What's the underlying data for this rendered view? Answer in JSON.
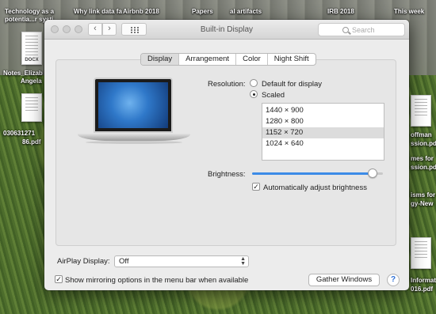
{
  "desktop": {
    "top_labels": [
      "Technology as a",
      "Why link data fa",
      "Airbnb 2018",
      "Papers",
      "al artifacts",
      "IRB 2018",
      "This week"
    ],
    "left_items": [
      {
        "line1": "potentia...r systi",
        "line2": ""
      },
      {
        "line1": "Notes_Elizab",
        "line2": "Angela"
      },
      {
        "line1": "030631271",
        "line2": "86.pdf"
      }
    ],
    "right_items": [
      "offman",
      "ssion.pdf",
      "mes for",
      "ssion.pdf",
      "isms for",
      "gy-New",
      "Informat",
      "016.pdf"
    ],
    "doc_badge": "DOCX"
  },
  "window": {
    "title": "Built-in Display",
    "search_placeholder": "Search",
    "nav_back": "‹",
    "nav_forward": "›"
  },
  "tabs": [
    {
      "label": "Display",
      "active": true
    },
    {
      "label": "Arrangement",
      "active": false
    },
    {
      "label": "Color",
      "active": false
    },
    {
      "label": "Night Shift",
      "active": false
    }
  ],
  "resolution": {
    "label": "Resolution:",
    "options": [
      {
        "label": "Default for display",
        "selected": false
      },
      {
        "label": "Scaled",
        "selected": true
      }
    ],
    "scaled_list": [
      {
        "label": "1440 × 900",
        "selected": false
      },
      {
        "label": "1280 × 800",
        "selected": false
      },
      {
        "label": "1152 × 720",
        "selected": true
      },
      {
        "label": "1024 × 640",
        "selected": false
      }
    ]
  },
  "brightness": {
    "label": "Brightness:",
    "level": 0.92,
    "auto_label": "Automatically adjust brightness",
    "auto_checked": true
  },
  "airplay": {
    "label": "AirPlay Display:",
    "value": "Off"
  },
  "mirroring": {
    "label": "Show mirroring options in the menu bar when available",
    "checked": true
  },
  "buttons": {
    "gather_windows": "Gather Windows",
    "help": "?"
  },
  "colors": {
    "accent": "#3b8be7",
    "selection": "#dcdcdc"
  }
}
